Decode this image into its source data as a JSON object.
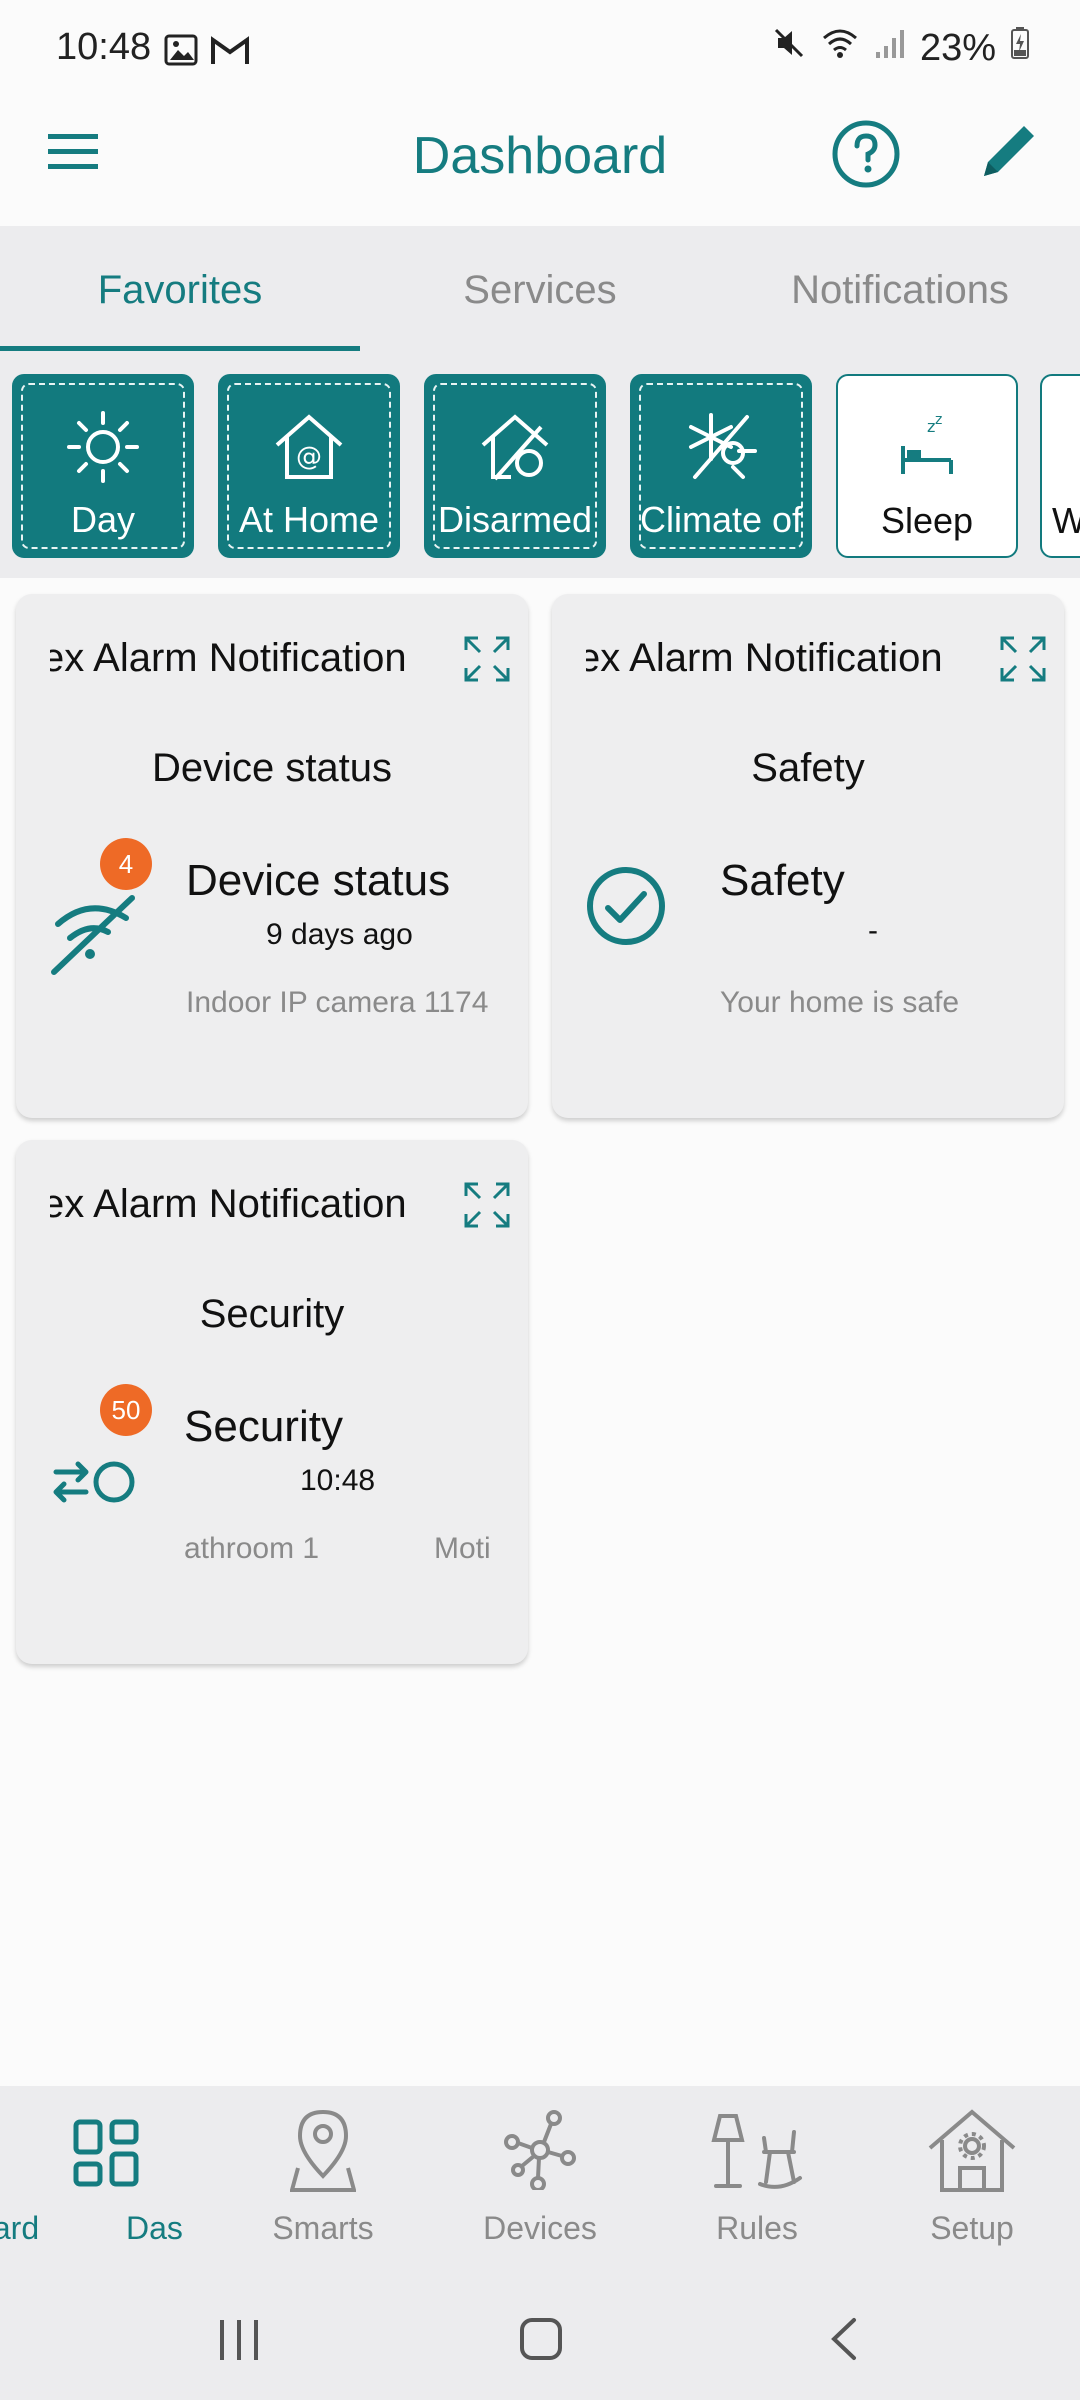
{
  "status_bar": {
    "time": "10:48",
    "battery": "23%"
  },
  "app_bar": {
    "title": "Dashboard",
    "menu_icon": "hamburger-menu-icon",
    "help_icon": "help-circle-icon",
    "edit_icon": "pencil-icon"
  },
  "tabs": [
    {
      "label": "Favorites",
      "active": true
    },
    {
      "label": "Services",
      "active": false
    },
    {
      "label": "Notifications",
      "active": false
    }
  ],
  "scenes": [
    {
      "label": "Day",
      "icon": "sun-icon",
      "active": true
    },
    {
      "label": "At Home",
      "icon": "home-at-icon",
      "active": true
    },
    {
      "label": "Disarmed",
      "icon": "home-disarmed-icon",
      "active": true
    },
    {
      "label": "Climate of",
      "icon": "climate-off-icon",
      "active": true
    },
    {
      "label": "Sleep",
      "icon": "sleep-bed-icon",
      "active": false
    },
    {
      "label": "W",
      "icon": "",
      "active": false
    }
  ],
  "cards": [
    {
      "header": "ex Alarm Notification",
      "subtitle": "Device status",
      "main": "Device status",
      "time": "9 days ago",
      "detail": "Indoor IP camera 1174",
      "badge": "4",
      "icon": "wifi-off-icon"
    },
    {
      "header": "ex Alarm Notification",
      "subtitle": "Safety",
      "main": "Safety",
      "time": "-",
      "detail": "Your home is safe",
      "icon": "check-circle-icon"
    },
    {
      "header": "ex Alarm Notification",
      "subtitle": "Security",
      "main": "Security",
      "time": "10:48",
      "detail": "athroom 1",
      "detail2": "Moti",
      "badge": "50",
      "icon": "arm-toggle-icon"
    }
  ],
  "bottom_nav": [
    {
      "label": "ard",
      "icon": "",
      "active": false
    },
    {
      "label": "Das",
      "icon": "dashboard-grid-icon",
      "active": true
    },
    {
      "label": "Smarts",
      "icon": "map-pin-icon",
      "active": false
    },
    {
      "label": "Devices",
      "icon": "network-icon",
      "active": false
    },
    {
      "label": "Rules",
      "icon": "lamp-chair-icon",
      "active": false
    },
    {
      "label": "Setup",
      "icon": "house-gear-icon",
      "active": false
    }
  ],
  "colors": {
    "accent": "#157c80",
    "badge": "#ee6a26",
    "tab_background": "#ececee"
  }
}
